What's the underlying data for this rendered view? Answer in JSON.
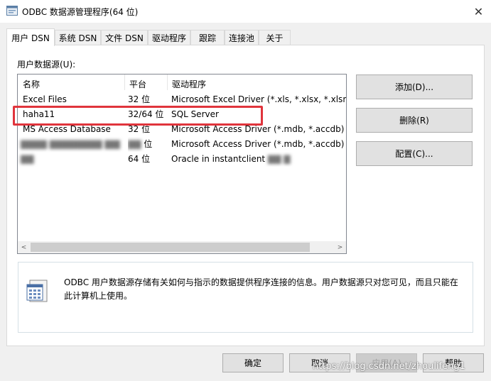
{
  "window": {
    "title": "ODBC 数据源管理程序(64 位)",
    "close_glyph": "✕"
  },
  "tabs": [
    {
      "label": "用户 DSN",
      "active": true
    },
    {
      "label": "系统 DSN",
      "active": false
    },
    {
      "label": "文件 DSN",
      "active": false
    },
    {
      "label": "驱动程序",
      "active": false
    },
    {
      "label": "跟踪",
      "active": false
    },
    {
      "label": "连接池",
      "active": false
    },
    {
      "label": "关于",
      "active": false
    }
  ],
  "user_dsn": {
    "section_label": "用户数据源(U):",
    "columns": {
      "name": "名称",
      "platform": "平台",
      "driver": "驱动程序"
    },
    "rows": [
      {
        "name": "Excel Files",
        "platform": "32 位",
        "driver": "Microsoft Excel Driver (*.xls, *.xlsx, *.xlsm, *"
      },
      {
        "name": "haha11",
        "platform": "32/64 位",
        "driver": "SQL Server"
      },
      {
        "name": "MS Access Database",
        "platform": "32 位",
        "driver": "Microsoft Access Driver (*.mdb, *.accdb)"
      },
      {
        "name": "",
        "platform": "位",
        "driver": "Microsoft Access Driver (*.mdb, *.accdb)"
      },
      {
        "name": "",
        "platform": "64 位",
        "driver": "Oracle in instantclient"
      }
    ],
    "scroll_left": "<",
    "scroll_right": ">",
    "buttons": {
      "add": "添加(D)...",
      "remove": "删除(R)",
      "configure": "配置(C)..."
    },
    "info_text": "ODBC 用户数据源存储有关如何与指示的数据提供程序连接的信息。用户数据源只对您可见，而且只能在此计算机上使用。"
  },
  "footer": {
    "ok": "确定",
    "cancel": "取消",
    "apply": "应用(A)",
    "help": "帮助"
  },
  "watermark": "https://blog.csdn.net/zhoulifeng1"
}
